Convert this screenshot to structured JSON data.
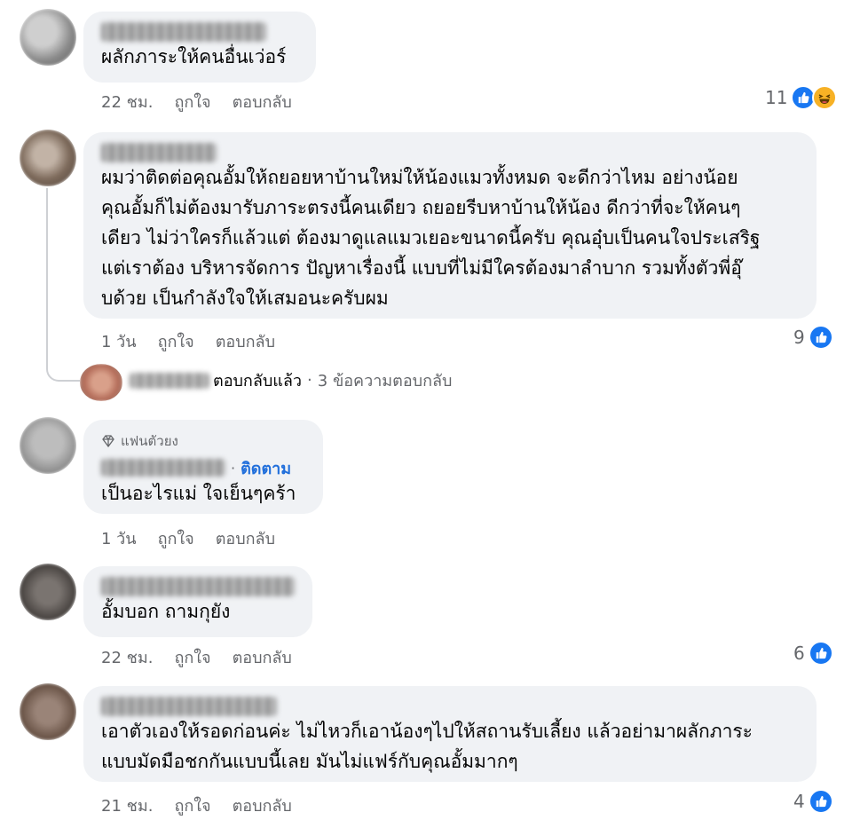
{
  "comments": [
    {
      "text": "ผลักภาระให้คนอื่นเว่อร์",
      "time": "22 ชม.",
      "like": "ถูกใจ",
      "reply": "ตอบกลับ",
      "reaction_count": "11",
      "reactions": [
        "like-icon",
        "haha-icon"
      ]
    },
    {
      "text": "ผมว่าติดต่อคุณอั้มให้ถยอยหาบ้านใหม่ให้น้องแมวทั้งหมด จะดีกว่าไหม อย่างน้อย\nคุณอั้มก็ไม่ต้องมารับภาระตรงนี้คนเดียว ถยอยรีบหาบ้านให้น้อง ดีกว่าที่จะให้คนๆ\nเดียว ไม่ว่าใครก็แล้วแต่ ต้องมาดูแลแมวเยอะขนาดนี้ครับ คุณอุ๋บเป็นคนใจประเสริฐ\nแต่เราต้อง บริหารจัดการ ปัญหาเรื่องนี้ แบบที่ไม่มีใครต้องมาลำบาก รวมทั้งตัวพี่อุ๊\nบด้วย เป็นกำลังใจให้เสมอนะครับผม",
      "time": "1 วัน",
      "like": "ถูกใจ",
      "reply": "ตอบกลับ",
      "reaction_count": "9",
      "reactions": [
        "like-icon"
      ],
      "replies": {
        "replied_label": "ตอบกลับแล้ว",
        "separator": "·",
        "count_label": "3 ข้อความตอบกลับ"
      }
    },
    {
      "badge": "แฟนตัวยง",
      "follow": "ติดตาม",
      "text": "เป็นอะไรแม่ ใจเย็นๆคร้า",
      "time": "1 วัน",
      "like": "ถูกใจ",
      "reply": "ตอบกลับ"
    },
    {
      "text": "อั้มบอก ถามกุยัง",
      "time": "22 ชม.",
      "like": "ถูกใจ",
      "reply": "ตอบกลับ",
      "reaction_count": "6",
      "reactions": [
        "like-icon"
      ]
    },
    {
      "text": "เอาตัวเองให้รอดก่อนค่ะ ไม่ไหวก็เอาน้องๆไปให้สถานรับเลี้ยง แล้วอย่ามาผลักภาระ\nแบบมัดมือชกกันแบบนี้เลย มันไม่แฟร์กับคุณอั้มมากๆ",
      "time": "21 ชม.",
      "like": "ถูกใจ",
      "reply": "ตอบกลับ",
      "reaction_count": "4",
      "reactions": [
        "like-icon"
      ]
    }
  ],
  "colors": {
    "bubble": "#f0f2f5",
    "secondary_text": "#65676b",
    "like_blue": "#1877f2",
    "follow_blue": "#216fdb",
    "haha_yellow": "#f7b125"
  }
}
